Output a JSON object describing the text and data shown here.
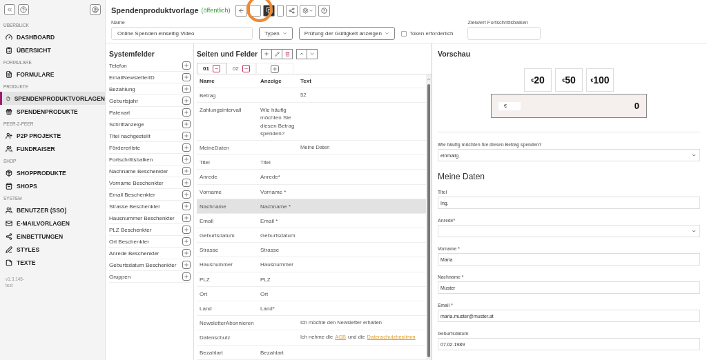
{
  "sidebar": {
    "sections": [
      {
        "title": "ÜBERBLICK",
        "items": [
          {
            "label": "DASHBOARD",
            "selected": false
          },
          {
            "label": "ÜBERSICHT",
            "selected": false
          }
        ]
      },
      {
        "title": "FORMULARE",
        "items": [
          {
            "label": "FORMULARE",
            "selected": false
          }
        ]
      },
      {
        "title": "PRODUKTE",
        "items": [
          {
            "label": "SPENDENPRODUKTVORLAGEN",
            "selected": true
          },
          {
            "label": "SPENDENPRODUKTE",
            "selected": false
          }
        ]
      },
      {
        "title": "PEER-2-PEER",
        "items": [
          {
            "label": "P2P PROJEKTE",
            "selected": false
          },
          {
            "label": "FUNDRAISER",
            "selected": false
          }
        ]
      },
      {
        "title": "SHOP",
        "items": [
          {
            "label": "SHOPPRODUKTE",
            "selected": false
          },
          {
            "label": "SHOPS",
            "selected": false
          }
        ]
      },
      {
        "title": "SYSTEM",
        "items": [
          {
            "label": "BENUTZER (SSO)",
            "selected": false
          },
          {
            "label": "E-MAILVORLAGEN",
            "selected": false
          },
          {
            "label": "EINBETTUNGEN",
            "selected": false
          },
          {
            "label": "STYLES",
            "selected": false
          },
          {
            "label": "TEXTE",
            "selected": false
          }
        ]
      }
    ],
    "version": [
      "v1.3.145-",
      "test"
    ]
  },
  "header": {
    "title": "Spendenproduktvorlage",
    "status": "(öffentlich)",
    "toolbar": [
      {
        "kind": "back",
        "selected": false
      },
      {
        "kind": "blank",
        "selected": false
      },
      {
        "kind": "copy",
        "selected": true
      },
      {
        "kind": "small",
        "selected": false
      },
      {
        "kind": "share",
        "selected": false
      },
      {
        "kind": "settings",
        "selected": false
      },
      {
        "kind": "help",
        "selected": false
      }
    ],
    "name_label": "Name",
    "name_value": "Online Spenden einseitig Video",
    "types_dropdown": "Typen",
    "validation_dropdown": "Prüfung der Gültigkeit anzeigen",
    "token": {
      "label": "Token erforderlich",
      "checked": false
    },
    "target_label": "Zielwert Fortschrittsbalken"
  },
  "system_fields": {
    "title": "Systemfelder",
    "items": [
      "Telefon",
      "EmailNewsletterID",
      "Bezahlung",
      "Geburtsjahr",
      "Patenart",
      "Schrittanzeige",
      "Titel nachgestellt",
      "Fördererliste",
      "Fortschrittsbalken",
      "Nachname Beschenkter",
      "Vorname Beschenkter",
      "Email Beschenkter",
      "Strasse Beschenkter",
      "Hausnummer Beschenkter",
      "PLZ Beschenkter",
      "Ort Beschenkter",
      "Anrede Beschenkter",
      "Geburtsdatum Beschenkter",
      "Gruppen"
    ]
  },
  "pages": {
    "title": "Seiten und Felder",
    "tabs": [
      {
        "label": "01",
        "selected": true
      },
      {
        "label": "02",
        "selected": false
      }
    ],
    "columns": [
      "Name",
      "Anzeige",
      "Text"
    ],
    "rows": [
      {
        "name": "Betrag",
        "display": "",
        "text": [
          {
            "t": "52",
            "link": false
          }
        ],
        "selected": false
      },
      {
        "name": "Zahlungsintervall",
        "display": "Wie häufig möchten Sie diesen Betrag spenden?",
        "text": [],
        "selected": false
      },
      {
        "name": "MeineDaten",
        "display": "",
        "text": [
          {
            "t": "Meine Daten",
            "link": false
          }
        ],
        "selected": false
      },
      {
        "name": "Titel",
        "display": "Titel",
        "text": [],
        "selected": false
      },
      {
        "name": "Anrede",
        "display": "Anrede*",
        "text": [],
        "selected": false
      },
      {
        "name": "Vorname",
        "display": "Vorname *",
        "text": [],
        "selected": false
      },
      {
        "name": "Nachname",
        "display": "Nachname *",
        "text": [],
        "selected": true
      },
      {
        "name": "Email",
        "display": "Email *",
        "text": [],
        "selected": false
      },
      {
        "name": "Geburtsdatum",
        "display": "Geburtsdatum",
        "text": [],
        "selected": false
      },
      {
        "name": "Strasse",
        "display": "Strasse",
        "text": [],
        "selected": false
      },
      {
        "name": "Hausnummer",
        "display": "Hausnummer",
        "text": [],
        "selected": false
      },
      {
        "name": "PLZ",
        "display": "PLZ",
        "text": [],
        "selected": false
      },
      {
        "name": "Ort",
        "display": "Ort",
        "text": [],
        "selected": false
      },
      {
        "name": "Land",
        "display": "Land*",
        "text": [],
        "selected": false
      },
      {
        "name": "NewsletterAbonnieren",
        "display": "",
        "text": [
          {
            "t": "Ich möchte den Newsletter erhalten",
            "link": false
          }
        ],
        "selected": false
      },
      {
        "name": "Datenschutz",
        "display": "",
        "text": [
          {
            "t": "Ich nehme die",
            "link": false
          },
          {
            "t": "AGB",
            "link": true
          },
          {
            "t": "und die",
            "link": false
          },
          {
            "t": "Datenschutzbestimm",
            "link": true
          }
        ],
        "selected": false
      },
      {
        "name": "Bezahlart",
        "display": "Bezahlart",
        "text": [],
        "selected": false
      }
    ]
  },
  "preview": {
    "title": "Vorschau",
    "amounts": [
      {
        "currency": "€",
        "value": "20"
      },
      {
        "currency": "€",
        "value": "50"
      },
      {
        "currency": "€",
        "value": "100"
      }
    ],
    "amount_field": {
      "currency": "€",
      "value": "0"
    },
    "interval": {
      "label": "Wie häufig möchten Sie diesen Betrag spenden?",
      "value": "einmalig"
    },
    "section_title": "Meine Daten",
    "fields": [
      {
        "kind": "text",
        "label": "Titel",
        "value": "Ing."
      },
      {
        "kind": "select",
        "label": "Anrede*"
      },
      {
        "kind": "text",
        "label": "Vorname *",
        "value": "Maria"
      },
      {
        "kind": "text",
        "label": "Nachname *",
        "value": "Muster"
      },
      {
        "kind": "text",
        "label": "Email *",
        "value": "maria.muster@muster.at"
      },
      {
        "kind": "text",
        "label": "Geburtsdatum",
        "value": "07.02.1989"
      }
    ]
  }
}
